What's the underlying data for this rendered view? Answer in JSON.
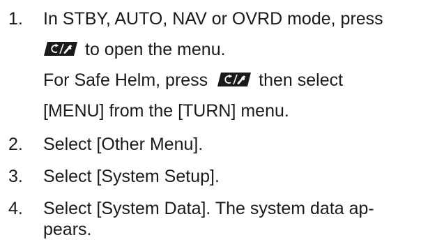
{
  "steps": [
    {
      "number": "1.",
      "line1": "In STBY, AUTO, NAV or OVRD mode, press",
      "line2_after_key": "to open the menu.",
      "note_line1_before_key": "For Safe Helm, press",
      "note_line1_after_key": "then select",
      "note_line2": "[MENU] from the [TURN] menu."
    },
    {
      "number": "2.",
      "text": "Select [Other Menu]."
    },
    {
      "number": "3.",
      "text": "Select [System Setup]."
    },
    {
      "number": "4.",
      "line1": "Select [System Data]. The system data ap-",
      "line2": "pears."
    }
  ],
  "key_icon": "menu-wrench-key-icon"
}
